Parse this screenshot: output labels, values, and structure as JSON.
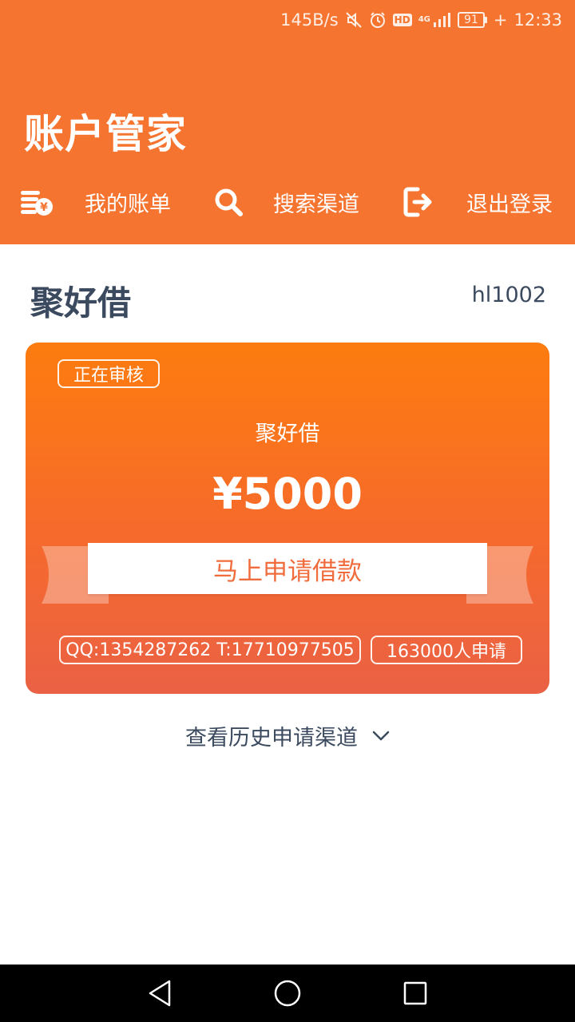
{
  "status_bar": {
    "net_speed": "145B/s",
    "hd_label": "HD",
    "network_type": "4G",
    "battery": "91",
    "time": "12:33"
  },
  "header": {
    "title": "账户管家"
  },
  "nav": {
    "items": [
      {
        "label": "我的账单",
        "icon": "bill-coins-icon"
      },
      {
        "label": "搜索渠道",
        "icon": "search-icon"
      },
      {
        "label": "退出登录",
        "icon": "logout-icon"
      }
    ]
  },
  "lender": {
    "name": "聚好借",
    "user_id": "hl1002"
  },
  "card": {
    "status": "正在审核",
    "name": "聚好借",
    "amount": "¥5000",
    "apply_label": "马上申请借款",
    "contact": "QQ:1354287262 T:17710977505",
    "applicants": "163000人申请"
  },
  "history": {
    "label": "查看历史申请渠道"
  },
  "colors": {
    "header_bg": "#f5742f",
    "card_top": "#fd7c0f",
    "card_bottom": "#ea6145",
    "text_dark": "#3b4a5e",
    "button_text": "#f06c3d"
  }
}
